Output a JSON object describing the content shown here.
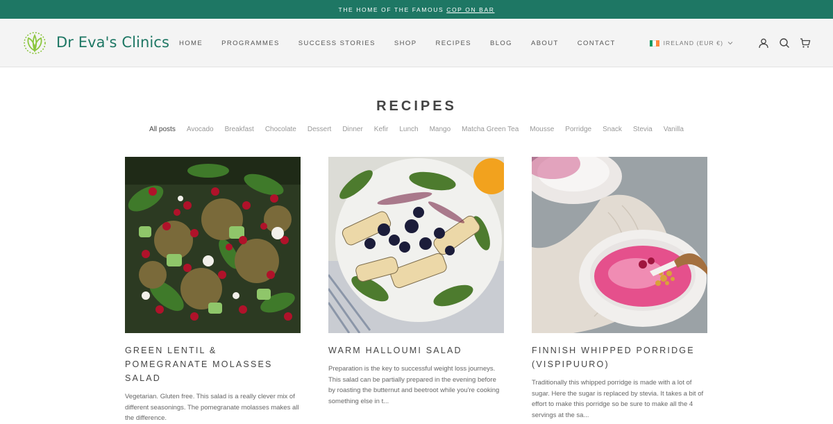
{
  "announcement": {
    "prefix": "THE HOME OF THE FAMOUS",
    "link": "COP ON BAR"
  },
  "brand": {
    "name": "Dr Eva's Clinics",
    "primary_color": "#1e7764",
    "logo_icon": "leaf-logo-icon"
  },
  "nav": {
    "items": [
      "HOME",
      "PROGRAMMES",
      "SUCCESS STORIES",
      "SHOP",
      "RECIPES",
      "BLOG",
      "ABOUT",
      "CONTACT"
    ]
  },
  "locale": {
    "label": "IRELAND (EUR €)",
    "flag_icon": "ireland-flag-icon"
  },
  "header_icons": [
    "account-icon",
    "search-icon",
    "cart-icon"
  ],
  "page": {
    "title": "RECIPES"
  },
  "filters": {
    "active": "All posts",
    "items": [
      "All posts",
      "Avocado",
      "Breakfast",
      "Chocolate",
      "Dessert",
      "Dinner",
      "Kefir",
      "Lunch",
      "Mango",
      "Matcha Green Tea",
      "Mousse",
      "Porridge",
      "Snack",
      "Stevia",
      "Vanilla"
    ]
  },
  "cards": [
    {
      "title": "GREEN LENTIL & POMEGRANATE MOLASSES SALAD",
      "excerpt": "Vegetarian. Gluten free.  This salad is a really clever mix of different seasonings. The pomegranate molasses makes all the difference."
    },
    {
      "title": "WARM HALLOUMI SALAD",
      "excerpt": "Preparation is the key to successful weight loss journeys. This salad can be partially prepared in the evening before by roasting the butternut and beetroot while you're cooking something else in t..."
    },
    {
      "title": "FINNISH WHIPPED PORRIDGE (VISPIPUURO)",
      "excerpt": "Traditionally this whipped porridge is made with a lot of sugar. Here the sugar is replaced by stevia. It takes a bit of effort to make this porridge so be sure to make all the 4 servings at the sa..."
    }
  ]
}
